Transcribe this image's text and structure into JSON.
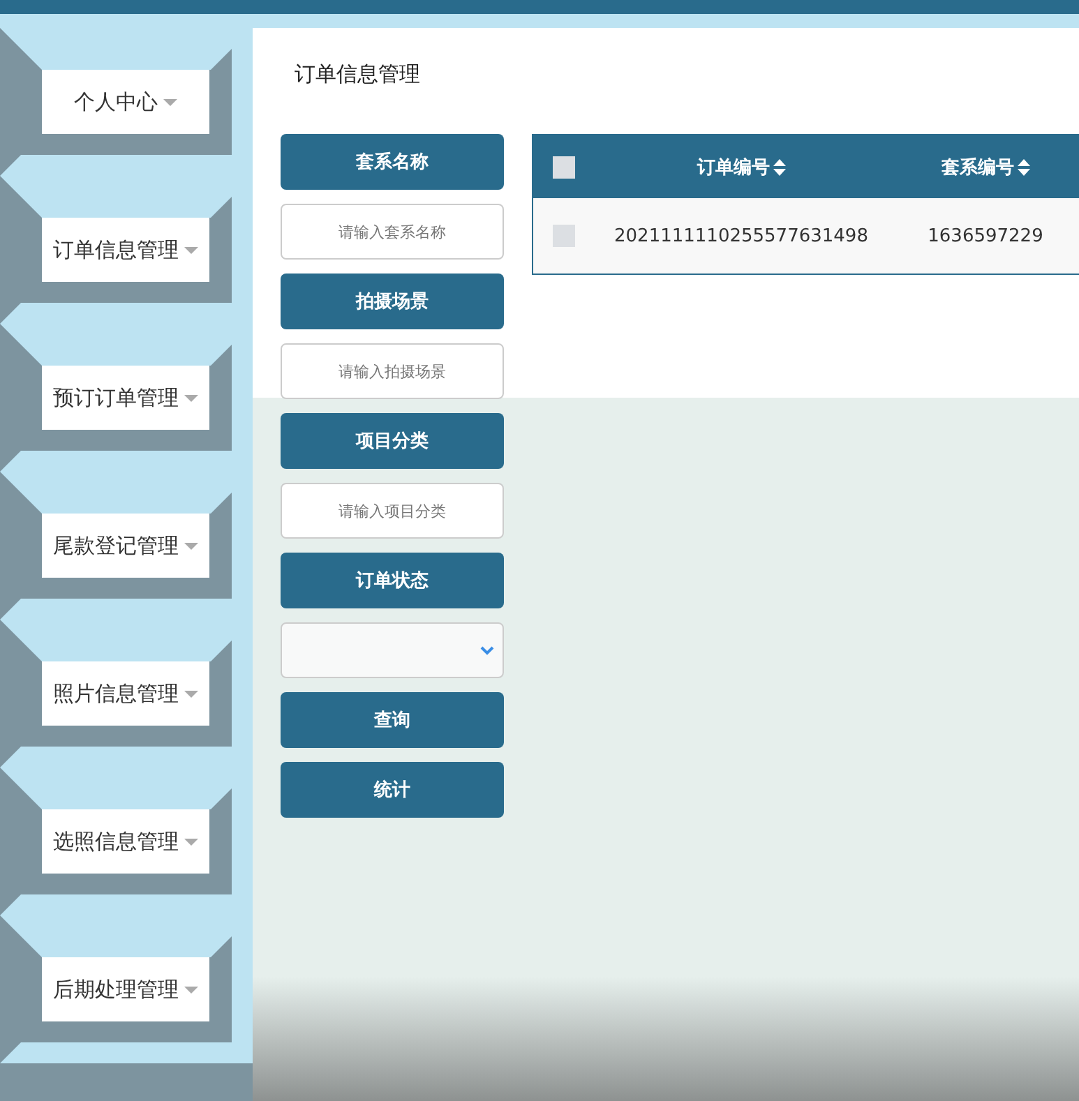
{
  "sidebar": {
    "items": [
      {
        "label": "个人中心",
        "expanded": false
      },
      {
        "label": "订单信息管理",
        "expanded": false
      },
      {
        "label": "预订订单管理",
        "expanded": false
      },
      {
        "label": "尾款登记管理",
        "expanded": false
      },
      {
        "label": "照片信息管理",
        "expanded": false
      },
      {
        "label": "选照信息管理",
        "expanded": false
      },
      {
        "label": "后期处理管理",
        "expanded": false
      }
    ]
  },
  "page_title": "订单信息管理",
  "filters": [
    {
      "kind": "text",
      "label": "套系名称",
      "placeholder": "请输入套系名称"
    },
    {
      "kind": "text",
      "label": "拍摄场景",
      "placeholder": "请输入拍摄场景"
    },
    {
      "kind": "text",
      "label": "项目分类",
      "placeholder": "请输入项目分类"
    },
    {
      "kind": "select",
      "label": "订单状态"
    }
  ],
  "actions": [
    "查询",
    "统计"
  ],
  "table": {
    "select_all": {
      "checked": false
    },
    "columns": [
      {
        "label": "订单编号",
        "sortable": true
      },
      {
        "label": "套系编号",
        "sortable": true
      }
    ],
    "rows": [
      {
        "checked": false,
        "cells": [
          "2021111110255577631498",
          "1636597229"
        ]
      }
    ]
  }
}
